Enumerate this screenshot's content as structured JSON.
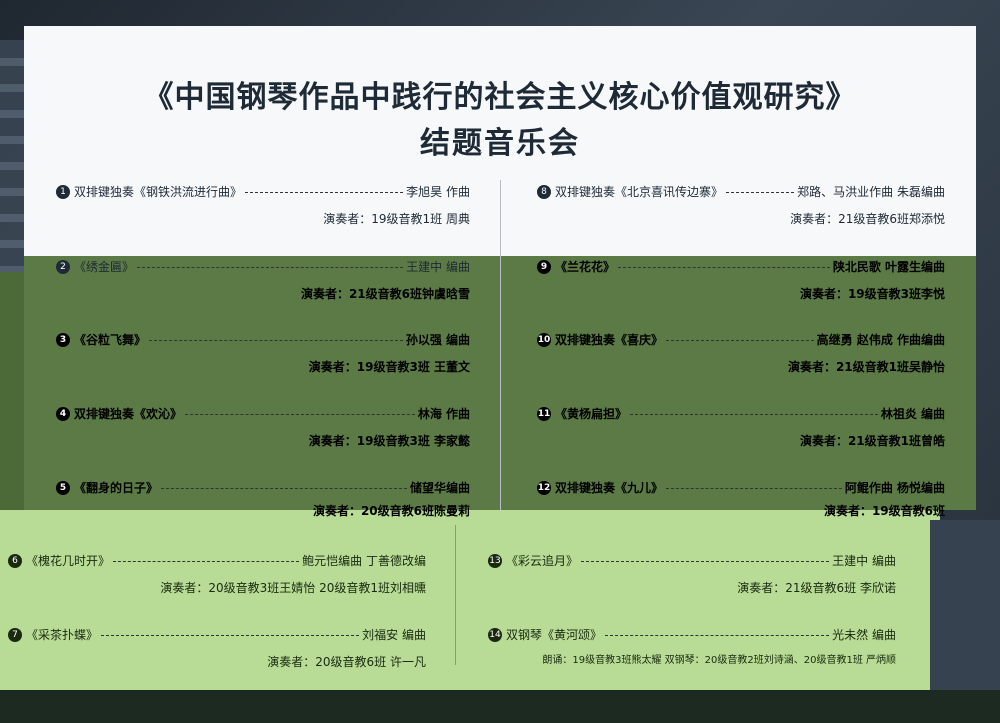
{
  "title": "《中国钢琴作品中践行的社会主义核心价值观研究》",
  "subtitle": "结题音乐会",
  "items": [
    {
      "num": "1",
      "piece": "双排键独奏《钢铁洪流进行曲》",
      "credit": "李旭昊 作曲",
      "performer": "演奏者：19级音教1班 周典"
    },
    {
      "num": "2",
      "piece": "《绣金匾》",
      "credit": "王建中 编曲",
      "performer": "演奏者：21级音教6班钟虞晗雪"
    },
    {
      "num": "3",
      "piece": "《谷粒飞舞》",
      "credit": "孙以强 编曲",
      "performer": "演奏者：19级音教3班 王董文"
    },
    {
      "num": "4",
      "piece": "双排键独奏《欢沁》",
      "credit": "林海 作曲",
      "performer": "演奏者：19级音教3班 李家懿"
    },
    {
      "num": "5",
      "piece": "《翻身的日子》",
      "credit": "储望华编曲",
      "performer": "演奏者：20级音教6班陈曼莉"
    },
    {
      "num": "6",
      "piece": "《槐花几时开》",
      "credit": "鲍元恺编曲 丁善德改编",
      "performer": "演奏者：20级音教3班王婧怡 20级音教1班刘相曛"
    },
    {
      "num": "7",
      "piece": "《采茶扑蝶》",
      "credit": "刘福安 编曲",
      "performer": "演奏者：20级音教6班 许一凡"
    },
    {
      "num": "8",
      "piece": "双排键独奏《北京喜讯传边寨》",
      "credit": "郑路、马洪业作曲 朱磊编曲",
      "performer": "演奏者：21级音教6班郑添悦"
    },
    {
      "num": "9",
      "piece": "《兰花花》",
      "credit": "陕北民歌 叶露生编曲",
      "performer": "演奏者：19级音教3班李悦"
    },
    {
      "num": "10",
      "piece": "双排键独奏《喜庆》",
      "credit": "高继勇 赵伟成 作曲编曲",
      "performer": "演奏者：21级音教1班吴静怡"
    },
    {
      "num": "11",
      "piece": "《黄杨扁担》",
      "credit": "林祖炎 编曲",
      "performer": "演奏者：21级音教1班曾皓"
    },
    {
      "num": "12",
      "piece": "双排键独奏《九儿》",
      "credit": "阿鲲作曲 杨悦编曲",
      "performer": "演奏者：19级音教6班"
    },
    {
      "num": "13",
      "piece": "《彩云追月》",
      "credit": "王建中 编曲",
      "performer": "演奏者：21级音教6班 李欣诺"
    },
    {
      "num": "14",
      "piece": "双钢琴《黄河颂》",
      "credit": "光未然 编曲",
      "performer": "朗诵：19级音教3班熊太耀   双钢琴：20级音教2班刘诗涵、20级音教1班 严炳顺"
    }
  ]
}
